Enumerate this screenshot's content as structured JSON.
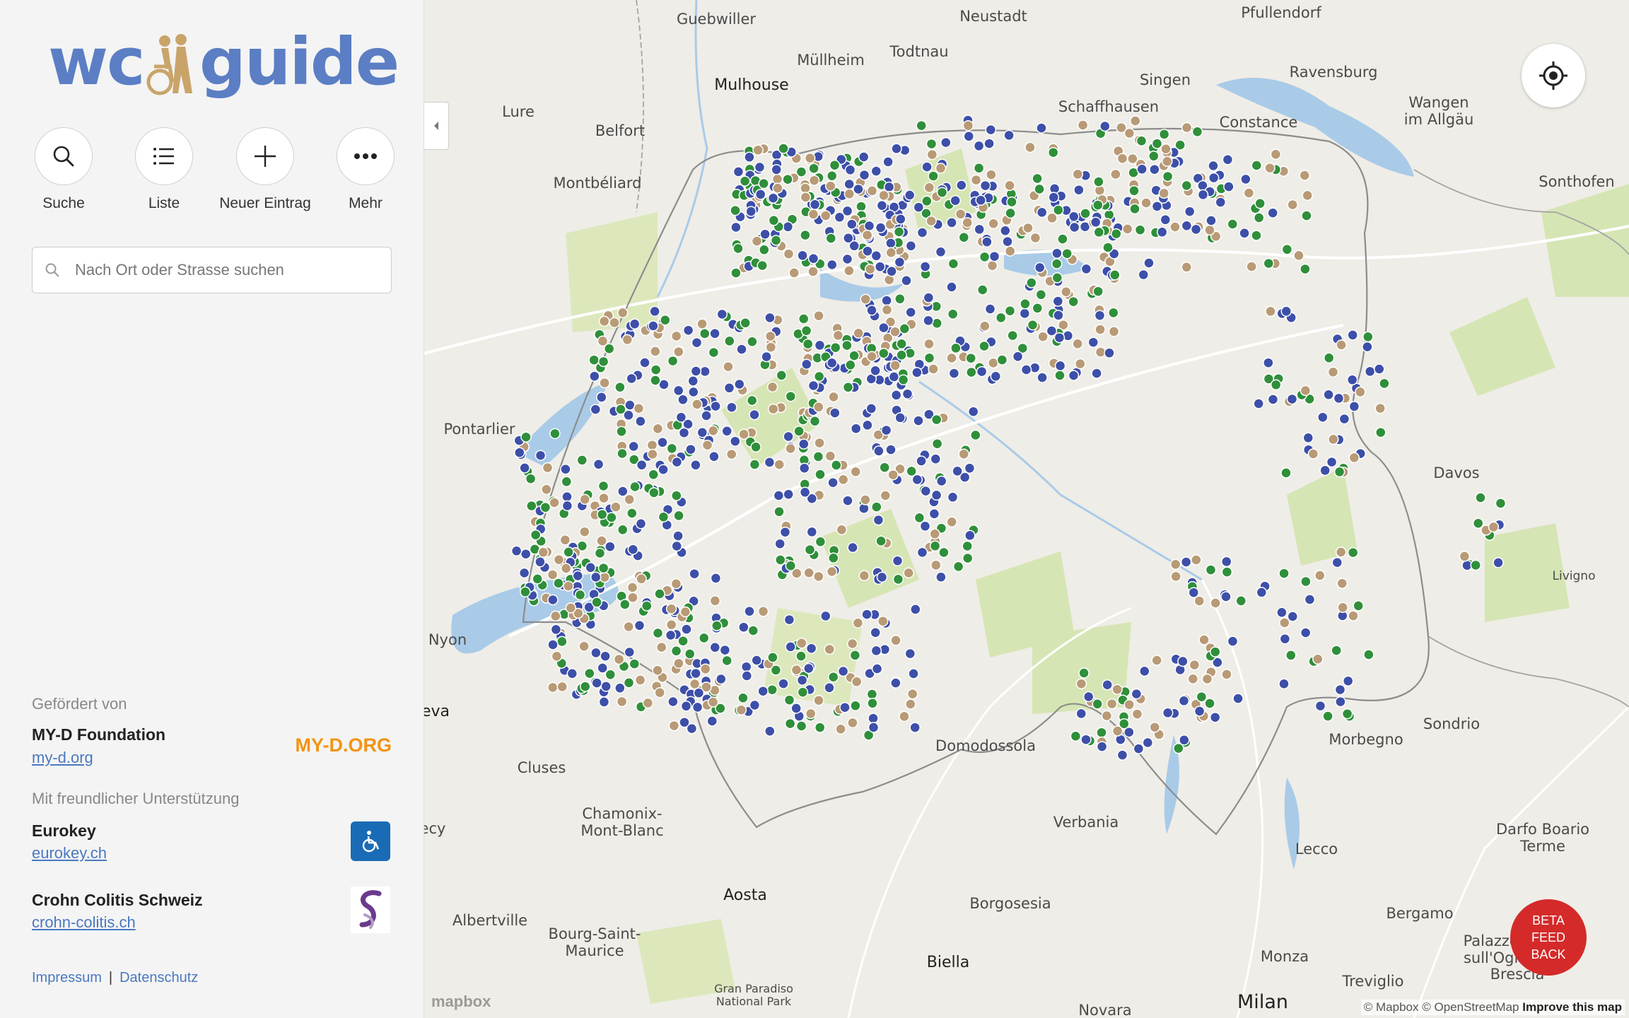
{
  "sidebar": {
    "logo": {
      "part1": "wc",
      "part2": "guide"
    },
    "actions": [
      {
        "label": "Suche",
        "icon": "search-icon"
      },
      {
        "label": "Liste",
        "icon": "list-icon"
      },
      {
        "label": "Neuer Eintrag",
        "icon": "plus-icon"
      },
      {
        "label": "Mehr",
        "icon": "more-icon"
      }
    ],
    "search_placeholder": "Nach Ort oder Strasse suchen",
    "funded_by_label": "Gefördert von",
    "funder": {
      "name": "MY-D Foundation",
      "link": "my-d.org",
      "logo_text": "MY-D.ORG"
    },
    "support_label": "Mit freundlicher Unterstützung",
    "supporters": [
      {
        "name": "Eurokey",
        "link": "eurokey.ch"
      },
      {
        "name": "Crohn Colitis Schweiz",
        "link": "crohn-colitis.ch"
      }
    ],
    "footer": {
      "impressum": "Impressum",
      "separator": "|",
      "datenschutz": "Datenschutz"
    }
  },
  "map": {
    "places": [
      {
        "name": "Guebwiller"
      },
      {
        "name": "Neustadt"
      },
      {
        "name": "Pfullendorf"
      },
      {
        "name": "Müllheim"
      },
      {
        "name": "Todtnau"
      },
      {
        "name": "Mulhouse"
      },
      {
        "name": "Singen"
      },
      {
        "name": "Ravensburg"
      },
      {
        "name": "Schaffhausen"
      },
      {
        "name": "Lure"
      },
      {
        "name": "Wangen\nim Allgäu"
      },
      {
        "name": "Belfort"
      },
      {
        "name": "Constance"
      },
      {
        "name": "Montbéliard"
      },
      {
        "name": "Sonthofen"
      },
      {
        "name": "Pontarlier"
      },
      {
        "name": "Davos"
      },
      {
        "name": "Livigno"
      },
      {
        "name": "Nyon"
      },
      {
        "name": "eva"
      },
      {
        "name": "Sondrio"
      },
      {
        "name": "Domodossola"
      },
      {
        "name": "Morbegno"
      },
      {
        "name": "Cluses"
      },
      {
        "name": "Chamonix-\nMont-Blanc"
      },
      {
        "name": "ecy"
      },
      {
        "name": "Verbania"
      },
      {
        "name": "Darfo Boario\nTerme"
      },
      {
        "name": "Lecco"
      },
      {
        "name": "Aosta"
      },
      {
        "name": "Albertville"
      },
      {
        "name": "Borgosesia"
      },
      {
        "name": "Bergamo"
      },
      {
        "name": "Bourg-Saint-\nMaurice"
      },
      {
        "name": "Biella"
      },
      {
        "name": "Monza"
      },
      {
        "name": "Palazzolo\nsull'Oglio"
      },
      {
        "name": "Gran Paradiso\nNational Park"
      },
      {
        "name": "Treviglio"
      },
      {
        "name": "Brescia"
      },
      {
        "name": "Novara"
      },
      {
        "name": "Milan"
      }
    ],
    "marker_colors": {
      "public_toilet": "#3d4fa8",
      "accessible": "#2f8f3a",
      "restaurant": "#b89a76",
      "special": "#7b3d99"
    },
    "beta_button": "BETA\nFEED\nBACK",
    "attribution": {
      "mapbox": "© Mapbox",
      "osm": "© OpenStreetMap",
      "improve": "Improve this map"
    },
    "mapbox_logo": "mapbox"
  }
}
